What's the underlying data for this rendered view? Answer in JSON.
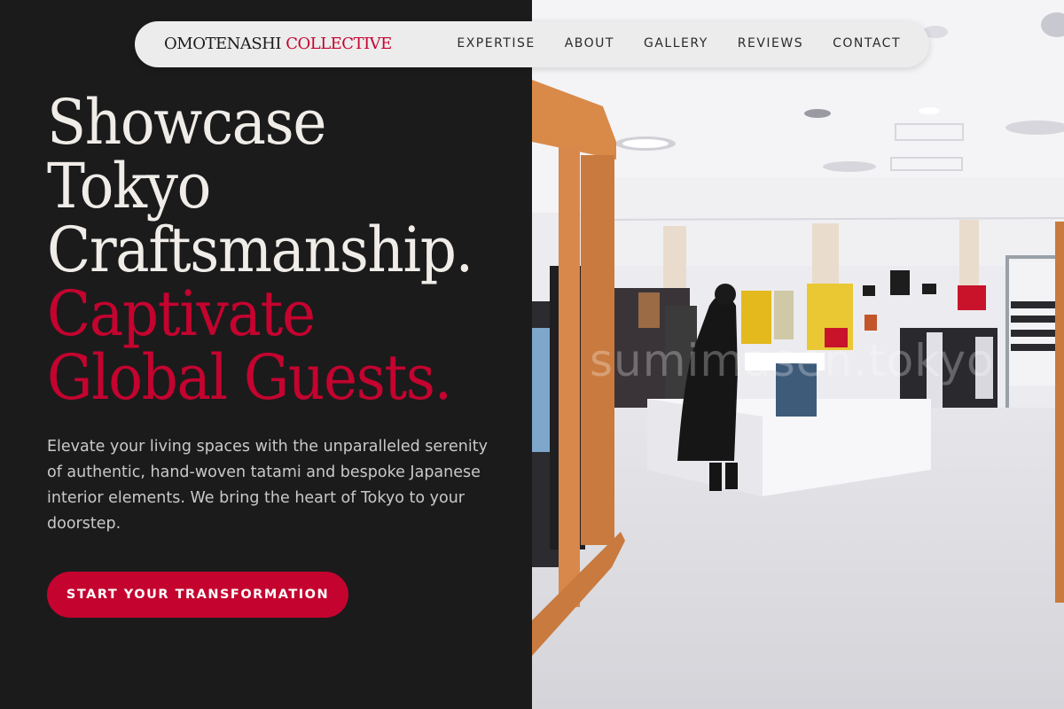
{
  "brand": {
    "name_part1": "OMOTENASHI",
    "name_part2": "COLLECTIVE"
  },
  "nav": {
    "items": [
      "EXPERTISE",
      "ABOUT",
      "GALLERY",
      "REVIEWS",
      "CONTACT"
    ]
  },
  "hero": {
    "headline_lines": [
      "Showcase",
      "Tokyo",
      "Craftsmanship.",
      "Captivate",
      "Global Guests."
    ],
    "body": "Elevate your living spaces with the unparalleled serenity of authentic, hand-woven tatami and bespoke Japanese interior elements. We bring the heart of Tokyo to your doorstep.",
    "cta_label": "START YOUR TRANSFORMATION"
  },
  "image": {
    "watermark": "sumimasen.tokyo"
  },
  "colors": {
    "accent": "#c4032f",
    "background": "#1b1b1c",
    "nav_bg": "#ececec"
  }
}
